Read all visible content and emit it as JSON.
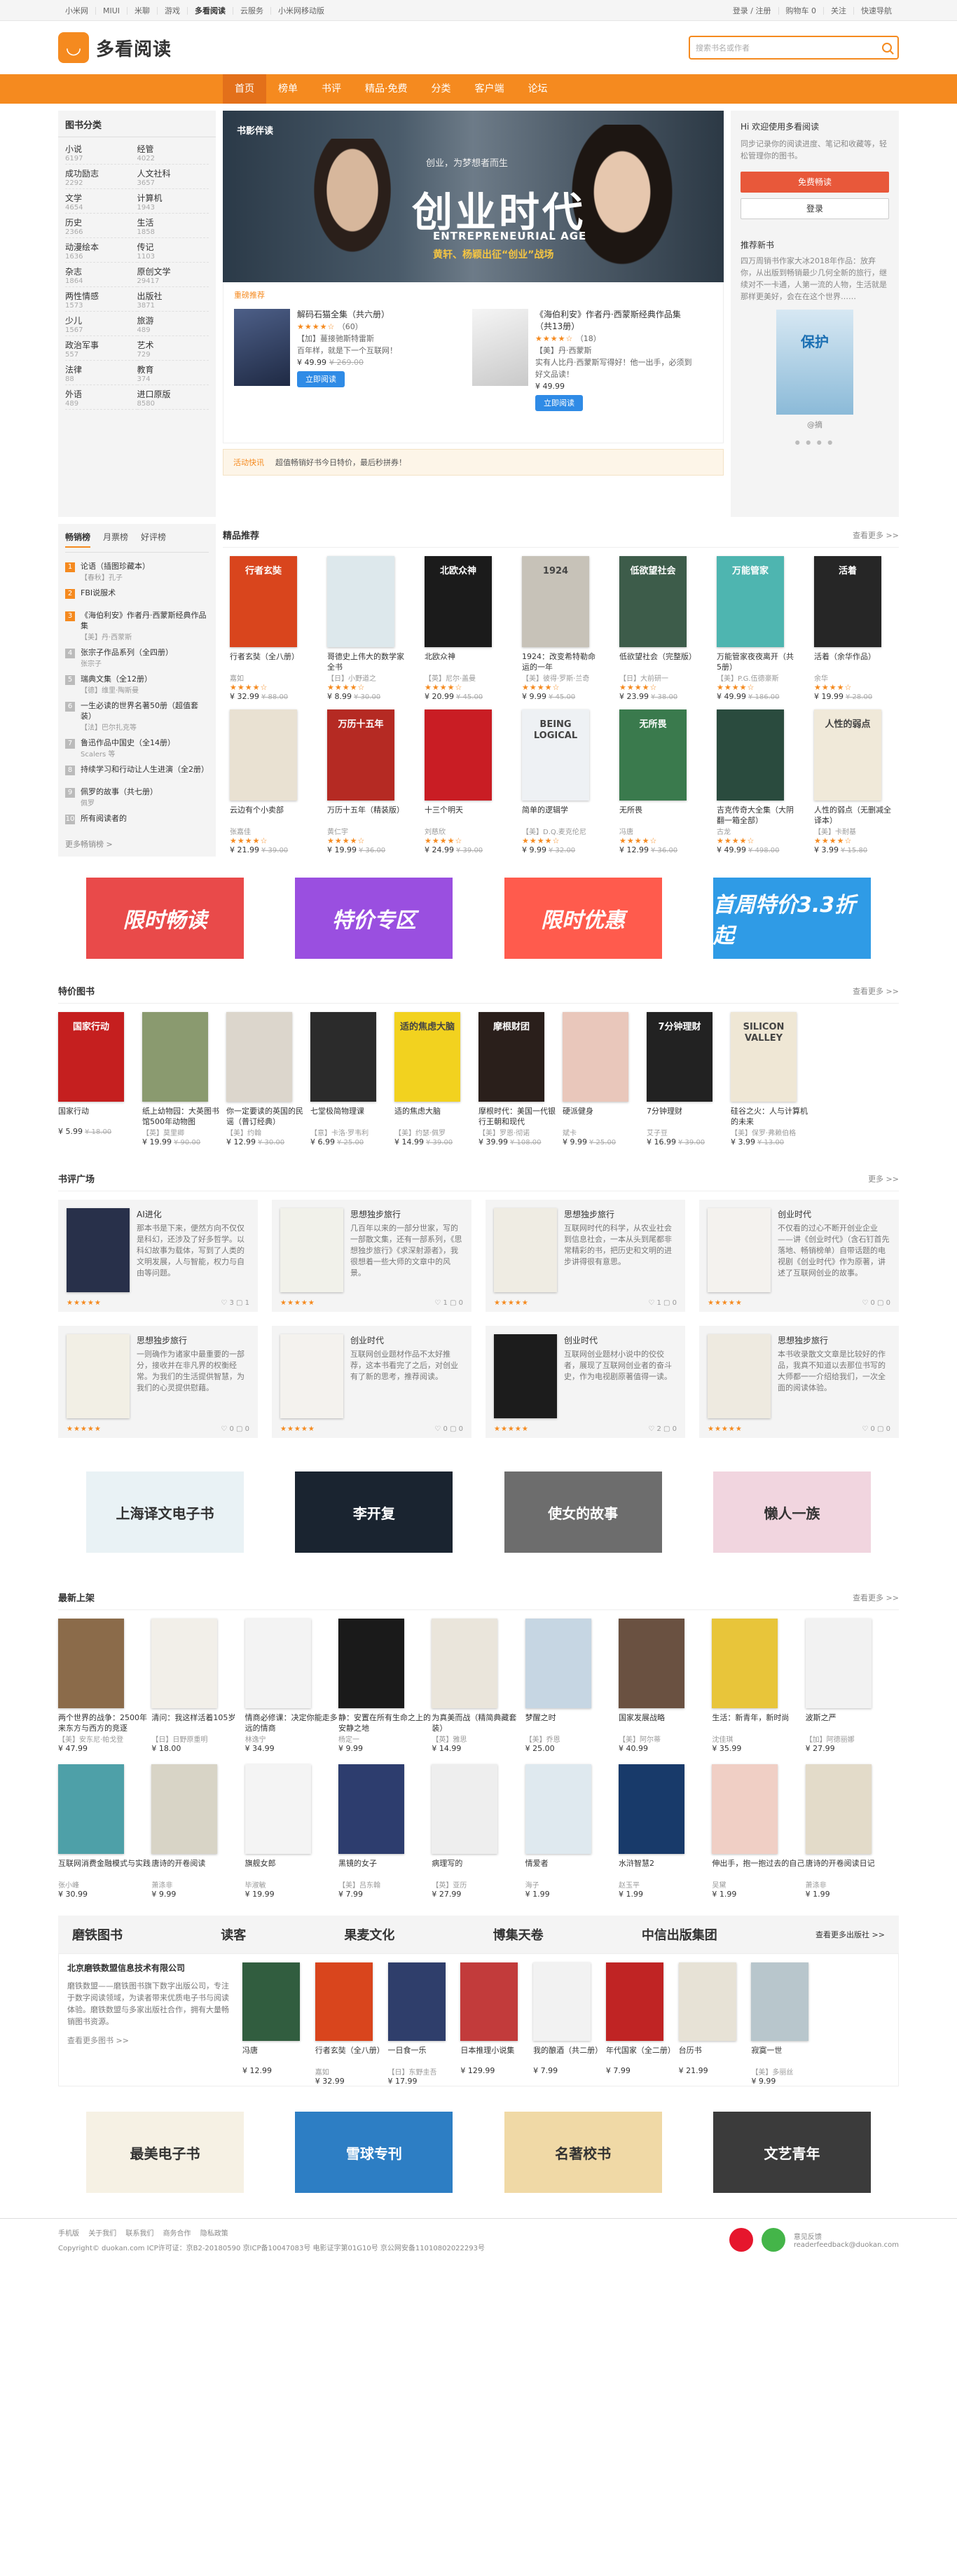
{
  "topbar": {
    "left": [
      "小米网",
      "MIUI",
      "米聊",
      "游戏",
      "多看阅读",
      "云服务",
      "小米网移动版"
    ],
    "current": "多看阅读",
    "right": [
      "登录 / 注册",
      "购物车 0",
      "关注",
      "快速导航"
    ]
  },
  "header": {
    "logo_text": "多看阅读",
    "search_placeholder": "搜索书名或作者"
  },
  "nav": {
    "items": [
      "首页",
      "榜单",
      "书评",
      "精品·免费",
      "分类",
      "客户端",
      "论坛"
    ],
    "active": "首页"
  },
  "categories": {
    "title": "图书分类",
    "items": [
      {
        "name": "小说",
        "count": "6197"
      },
      {
        "name": "经管",
        "count": "4022"
      },
      {
        "name": "成功励志",
        "count": "2292"
      },
      {
        "name": "人文社科",
        "count": "3657"
      },
      {
        "name": "文学",
        "count": "4654"
      },
      {
        "name": "计算机",
        "count": "1943"
      },
      {
        "name": "历史",
        "count": "2366"
      },
      {
        "name": "生活",
        "count": "1858"
      },
      {
        "name": "动漫绘本",
        "count": "1636"
      },
      {
        "name": "传记",
        "count": "1103"
      },
      {
        "name": "杂志",
        "count": "1864"
      },
      {
        "name": "原创文学",
        "count": "29417"
      },
      {
        "name": "两性情感",
        "count": "1573"
      },
      {
        "name": "出版社",
        "count": "3871"
      },
      {
        "name": "少儿",
        "count": "1567"
      },
      {
        "name": "旅游",
        "count": "489"
      },
      {
        "name": "政治军事",
        "count": "557"
      },
      {
        "name": "艺术",
        "count": "729"
      },
      {
        "name": "法律",
        "count": "88"
      },
      {
        "name": "教育",
        "count": "374"
      },
      {
        "name": "外语",
        "count": "489"
      },
      {
        "name": "进口原版",
        "count": "8580"
      }
    ]
  },
  "banner": {
    "tag": "书影伴读",
    "subtitle": "创业，为梦想者而生",
    "title": "创业时代",
    "english": "ENTREPRENEURIAL AGE",
    "slogan": "黄轩、杨颖出征“创业”战场"
  },
  "recommend": {
    "label": "重磅推荐",
    "books": [
      {
        "title": "解码石猫全集（共六册）",
        "rating": "★★★★☆",
        "rating_count": "（60）",
        "desc": "【加】蔓接驰斯特雷斯",
        "blurb": "百年样，就是下一个互联网！",
        "price": "¥ 49.99",
        "old_price": "¥ 269.00",
        "button": "立即阅读"
      },
      {
        "title": "《海伯利安》作者丹·西蒙斯经典作品集（共13册）",
        "rating": "★★★★☆",
        "rating_count": "（18）",
        "desc": "【美】丹·西蒙斯",
        "blurb": "实有人比丹·西蒙斯写得好！他一出手，必须到好文品读！",
        "price": "¥ 49.99",
        "old_price": "",
        "button": "立即阅读"
      }
    ]
  },
  "activity": {
    "label": "活动快讯",
    "text": "超值畅销好书今日特价，最后秒拼券！"
  },
  "side": {
    "hi": "Hi 欢迎使用多看阅读",
    "desc": "同步记录你的阅读进度、笔记和收藏等，轻松管理你的图书。",
    "btn_primary": "免费畅读",
    "btn_secondary": "登录",
    "news_title": "推荐新书",
    "news_desc": "四万周销书作家大冰2018年作品：放弃你，从出版到畅销最少几何全新的旅行，继续对不一卡通，人第一流的人物，生活就是那样更美好，会在在这个世界……",
    "book_title": "保护",
    "book_author": "@摘"
  },
  "ranking": {
    "tabs": [
      "畅销榜",
      "月票榜",
      "好评榜"
    ],
    "active": "畅销榜",
    "items": [
      {
        "n": "1",
        "t": "论语（插图珍藏本）",
        "a": "【春秋】孔子"
      },
      {
        "n": "2",
        "t": "FBI说服术",
        "a": ""
      },
      {
        "n": "3",
        "t": "《海伯利安》作者丹·西蒙斯经典作品集",
        "a": "【美】丹·西蒙斯"
      },
      {
        "n": "4",
        "t": "张宗子作品系列（全四册）",
        "a": "张宗子"
      },
      {
        "n": "5",
        "t": "瑞典文集（全12册）",
        "a": "【德】维里·陶斯曼"
      },
      {
        "n": "6",
        "t": "一生必读的世界名著50册（超值套装）",
        "a": "【法】巴尔扎克等"
      },
      {
        "n": "7",
        "t": "鲁迅作品中国史（全14册）",
        "a": "Scalers 等"
      },
      {
        "n": "8",
        "t": "持续学习和行动让人生进演（全2册）",
        "a": ""
      },
      {
        "n": "9",
        "t": "佩罗的故事（共七册）",
        "a": "佩罗"
      },
      {
        "n": "10",
        "t": "所有阅读者的",
        "a": ""
      }
    ],
    "more": "更多畅销榜 >"
  },
  "picks": {
    "title": "精品推荐",
    "more": "查看更多 >>",
    "books": [
      {
        "t": "行者玄奘（全八册）",
        "a": "嘉如",
        "r": "★★★★☆",
        "p": "¥ 32.99",
        "o": "¥ 88.00",
        "cov": "#d9451d",
        "txt": "行者玄奘"
      },
      {
        "t": "哥德史上伟大的数学家全书",
        "a": "【日】小野道之",
        "r": "★★★★☆",
        "p": "¥ 8.99",
        "o": "¥ 30.00",
        "cov": "#dde8ec",
        "txt": ""
      },
      {
        "t": "北欧众神",
        "a": "【英】尼尔·盖曼",
        "r": "★★★★☆",
        "p": "¥ 20.99",
        "o": "¥ 45.00",
        "cov": "#1b1b1b",
        "txt": "北欧众神"
      },
      {
        "t": "1924：改变希特勒命运的一年",
        "a": "【美】彼得·罗斯·兰奇",
        "r": "★★★★☆",
        "p": "¥ 9.99",
        "o": "¥ 45.00",
        "cov": "#c7c2b8",
        "txt": "1924"
      },
      {
        "t": "低欲望社会（完整版）",
        "a": "【日】大前研一",
        "r": "★★★★☆",
        "p": "¥ 23.99",
        "o": "¥ 38.00",
        "cov": "#3d5c4a",
        "txt": "低欲望社会"
      },
      {
        "t": "万能管家夜夜离开（共5册）",
        "a": "【美】P.G.伍德豪斯",
        "r": "★★★★☆",
        "p": "¥ 49.99",
        "o": "¥ 186.00",
        "cov": "#4eb5b0",
        "txt": "万能管家"
      },
      {
        "t": "活着（余华作品）",
        "a": "余华",
        "r": "★★★★☆",
        "p": "¥ 19.99",
        "o": "¥ 28.00",
        "cov": "#262626",
        "txt": "活着"
      },
      {
        "t": "云边有个小卖部",
        "a": "张嘉佳",
        "r": "★★★★☆",
        "p": "¥ 21.99",
        "o": "¥ 39.00",
        "cov": "#e9e1d2",
        "txt": ""
      },
      {
        "t": "万历十五年（精装版）",
        "a": "黄仁宇",
        "r": "★★★★☆",
        "p": "¥ 19.99",
        "o": "¥ 36.00",
        "cov": "#b52a23",
        "txt": "万历十五年"
      },
      {
        "t": "十三个明天",
        "a": "刘慈欣",
        "r": "★★★★☆",
        "p": "¥ 24.99",
        "o": "¥ 39.00",
        "cov": "#c91d24",
        "txt": ""
      },
      {
        "t": "简单的逻辑学",
        "a": "【美】D.Q.麦克伦尼",
        "r": "★★★★☆",
        "p": "¥ 9.99",
        "o": "¥ 32.00",
        "cov": "#eef1f4",
        "txt": "BEING LOGICAL"
      },
      {
        "t": "无所畏",
        "a": "冯唐",
        "r": "★★★★☆",
        "p": "¥ 12.99",
        "o": "¥ 36.00",
        "cov": "#3a7a4d",
        "txt": "无所畏"
      },
      {
        "t": "吉克传奇大全集（大阴翻一箱全部）",
        "a": "古龙",
        "r": "★★★★☆",
        "p": "¥ 49.99",
        "o": "¥ 498.00",
        "cov": "#2a4b3e",
        "txt": ""
      },
      {
        "t": "人性的弱点（无删减全译本）",
        "a": "【美】卡耐基",
        "r": "★★★★☆",
        "p": "¥ 3.99",
        "o": "¥ 15.80",
        "cov": "#f0e9d9",
        "txt": "人性的弱点"
      }
    ]
  },
  "promos": [
    {
      "text": "限时畅读",
      "bg": "#e94a4a"
    },
    {
      "text": "特价专区",
      "bg": "#9a4fe0"
    },
    {
      "text": "限时优惠",
      "bg": "#ff5b4d"
    },
    {
      "text": "首周特价3.3折起",
      "bg": "#2f9be6"
    }
  ],
  "specials": {
    "title": "特价图书",
    "more": "查看更多 >>",
    "books": [
      {
        "t": "国家行动",
        "a": "",
        "p": "¥ 5.99",
        "o": "¥ 18.00",
        "cov": "#c51f1f",
        "txt": "国家行动"
      },
      {
        "t": "纸上幼物园：大英图书馆500年动物图",
        "a": "【英】莫里卿",
        "p": "¥ 19.99",
        "o": "¥ 90.00",
        "cov": "#8a9a6f",
        "txt": ""
      },
      {
        "t": "你一定要读的英国的民谣（普订经典）",
        "a": "【美】约翰",
        "p": "¥ 12.99",
        "o": "¥ 30.00",
        "cov": "#dcd6cc",
        "txt": ""
      },
      {
        "t": "七堂极简物理课",
        "a": "【意】卡洛·罗韦利",
        "p": "¥ 6.99",
        "o": "¥ 25.00",
        "cov": "#2b2b2b",
        "txt": ""
      },
      {
        "t": "适的焦虑大脑",
        "a": "【美】约瑟·佩罗",
        "p": "¥ 14.99",
        "o": "¥ 39.00",
        "cov": "#f2d21f",
        "txt": "适的焦虑大脑"
      },
      {
        "t": "摩根时代：美国一代银行王朝和现代",
        "a": "【美】罗恩·彻诺",
        "p": "¥ 39.99",
        "o": "¥ 108.00",
        "cov": "#2a1f1b",
        "txt": "摩根财团"
      },
      {
        "t": "硬派健身",
        "a": "斌卡",
        "p": "¥ 9.99",
        "o": "¥ 25.00",
        "cov": "#e9c7bb",
        "txt": ""
      },
      {
        "t": "7分钟理财",
        "a": "艾子豆",
        "p": "¥ 16.99",
        "o": "¥ 39.00",
        "cov": "#222",
        "txt": "7分钟理财"
      },
      {
        "t": "硅谷之火：人与计算机的未来",
        "a": "【美】保罗·弗赖伯格",
        "p": "¥ 3.99",
        "o": "¥ 13.00",
        "cov": "#efe7d5",
        "txt": "SILICON VALLEY"
      }
    ]
  },
  "plaza": {
    "title": "书评广场",
    "more": "更多 >>",
    "cards": [
      {
        "t": "AI进化",
        "d": "那本书是下来，便然方向不仅仅是科幻，还涉及了好多哲学。以科幻故事为载体，写到了人类的文明发展，人与智能，权力与自由等问题。",
        "likes": "3",
        "cmt": "1",
        "cov": "#28304a"
      },
      {
        "t": "思想独步旅行",
        "d": "几百年以来的一部分世家，写的一部散文集，还有一部系列，《思想独步旅行》《求深射源者》，我很想着一些大师的文章中的风景。",
        "likes": "1",
        "cmt": "0",
        "cov": "#f1f1ea"
      },
      {
        "t": "思想独步旅行",
        "d": "互联网时代的科学，从农业社会到信息社会，一本从头到尾都非常精彩的书，把历史和文明的进步讲得很有意思。",
        "likes": "1",
        "cmt": "0",
        "cov": "#efece3"
      },
      {
        "t": "创业时代",
        "d": "不仅看的过心不断开创业企业——讲《创业时代》（含石钉首先落地、畅销榜单）自带话题的电视剧《创业时代》作为原著，讲述了互联网创业的故事。",
        "likes": "0",
        "cmt": "0",
        "cov": "#f4f2ee"
      },
      {
        "t": "思想独步旅行",
        "d": "一则确作为诸家中最重要的一部分，接收并在非凡界的权衡经常。为我们的生活提供智慧，为我们的心灵提供慰藉。",
        "likes": "0",
        "cmt": "0",
        "cov": "#f2efe5"
      },
      {
        "t": "创业时代",
        "d": "互联网创业题材作品不太好推荐，这本书看完了之后，对创业有了新的思考，推荐阅读。",
        "likes": "0",
        "cmt": "0",
        "cov": "#f4f2ee"
      },
      {
        "t": "创业时代",
        "d": "互联网创业题材小说中的佼佼者，展现了互联网创业者的奋斗史，作为电视剧原著值得一读。",
        "likes": "2",
        "cmt": "0",
        "cov": "#1c1c1c"
      },
      {
        "t": "思想独步旅行",
        "d": "本书收录散文文章是比较好的作品，我真不知道以去那位书写的大师都一一介绍给我们，一次全面的阅读体验。",
        "likes": "0",
        "cmt": "0",
        "cov": "#eeeae0"
      }
    ]
  },
  "banners2": [
    {
      "name": "上海译文电子书",
      "bg": "#e9f2f5"
    },
    {
      "name": "李开复",
      "bg": "#1a2430"
    },
    {
      "name": "使女的故事",
      "bg": "#6d6d6d"
    },
    {
      "name": "懒人一族",
      "bg": "#f1d5df"
    }
  ],
  "latest": {
    "title": "最新上架",
    "more": "查看更多 >>",
    "books": [
      {
        "t": "两个世界的战争：2500年来东方与西方的竞逐",
        "a": "【美】安东尼·帕戈登",
        "p": "¥ 47.99",
        "o": "",
        "cov": "#8b6b4a"
      },
      {
        "t": "清问：我这样活着105岁",
        "a": "【日】日野原重明",
        "p": "¥ 18.00",
        "o": "",
        "cov": "#f2efe9"
      },
      {
        "t": "情商必修课：决定你能走多远的情商",
        "a": "林逸宁",
        "p": "¥ 34.99",
        "o": "",
        "cov": "#f3f3f3"
      },
      {
        "t": "静：安置在所有生命之上的安静之地",
        "a": "杨定一",
        "p": "¥ 9.99",
        "o": "",
        "cov": "#1a1a1a"
      },
      {
        "t": "为真美而战（精简典藏套装）",
        "a": "【英】雅思",
        "p": "¥ 14.99",
        "o": "",
        "cov": "#eae5db"
      },
      {
        "t": "梦醒之时",
        "a": "【美】乔恩",
        "p": "¥ 25.00",
        "o": "",
        "cov": "#c6d6e3"
      },
      {
        "t": "国家发展战略",
        "a": "【美】阿尔蒂",
        "p": "¥ 40.99",
        "o": "",
        "cov": "#6a5141"
      },
      {
        "t": "生活：新青年，新时尚",
        "a": "沈佳琪",
        "p": "¥ 35.99",
        "o": "",
        "cov": "#e8c53a"
      },
      {
        "t": "波斯之严",
        "a": "【加】阿德丽娜",
        "p": "¥ 27.99",
        "o": "",
        "cov": "#f2f2f2"
      },
      {
        "t": "互联网消费金融模式与实践",
        "a": "张小峰",
        "p": "¥ 30.99",
        "o": "",
        "cov": "#4ea0a8"
      },
      {
        "t": "唐诗的开卷阅读",
        "a": "萧涤非",
        "p": "¥ 9.99",
        "o": "",
        "cov": "#d8d4c6"
      },
      {
        "t": "旗舰女郎",
        "a": "毕淑敏",
        "p": "¥ 19.99",
        "o": "",
        "cov": "#f4f4f4"
      },
      {
        "t": "黑镜的女子",
        "a": "【美】吕东翰",
        "p": "¥ 7.99",
        "o": "",
        "cov": "#2d3d6e"
      },
      {
        "t": "病理写的",
        "a": "【英】亚历",
        "p": "¥ 27.99",
        "o": "",
        "cov": "#eee"
      },
      {
        "t": "情爱者",
        "a": "海子",
        "p": "¥ 1.99",
        "o": "",
        "cov": "#dfe9ef"
      },
      {
        "t": "水浒智慧2",
        "a": "赵玉平",
        "p": "¥ 1.99",
        "o": "",
        "cov": "#183a6a"
      },
      {
        "t": "伸出手，抱一抱过去的自己",
        "a": "吴黛",
        "p": "¥ 1.99",
        "o": "",
        "cov": "#f0cfc5"
      },
      {
        "t": "唐诗的开卷阅读日记",
        "a": "萧涤非",
        "p": "¥ 1.99",
        "o": "",
        "cov": "#e3dbc9"
      }
    ]
  },
  "publishers": {
    "names": [
      "磨铁图书",
      "读客",
      "果麦文化",
      "博集天卷",
      "中信出版集团"
    ],
    "more": "查看更多出版社 >>",
    "company": "北京磨铁数盟信息技术有限公司",
    "company_desc": "磨铁数盟——磨铁图书旗下数字出版公司，专注于数字阅读领域，为读者带来优质电子书与阅读体验。磨铁数盟与多家出版社合作，拥有大量畅销图书资源。",
    "company_more": "查看更多图书 >>",
    "books": [
      {
        "t": "冯唐",
        "a": "",
        "p": "¥ 12.99",
        "cov": "#315d3f"
      },
      {
        "t": "行者玄奘（全八册）",
        "a": "嘉如",
        "p": "¥ 32.99",
        "cov": "#d9451d"
      },
      {
        "t": "一日食一乐",
        "a": "【日】东野圭吾",
        "p": "¥ 17.99",
        "cov": "#2f3e6b"
      },
      {
        "t": "日本推理小说集",
        "a": "",
        "p": "¥ 129.99",
        "cov": "#c23b3b"
      },
      {
        "t": "我的酿酒（共二册）",
        "a": "",
        "p": "¥ 7.99",
        "cov": "#f2f2f2"
      },
      {
        "t": "年代国家（全二册）",
        "a": "",
        "p": "¥ 7.99",
        "cov": "#c02424"
      },
      {
        "t": "台历书",
        "a": "",
        "p": "¥ 21.99",
        "cov": "#e7e2d6"
      },
      {
        "t": "寂寞一世",
        "a": "【美】多丽丝",
        "p": "¥ 9.99",
        "cov": "#b8c6cc"
      }
    ]
  },
  "banners3": [
    {
      "name": "最美电子书",
      "bg": "#f6f1e4"
    },
    {
      "name": "雪球专刊",
      "bg": "#2d7ec4"
    },
    {
      "name": "名著校书",
      "bg": "#f0d9a6"
    },
    {
      "name": "文艺青年",
      "bg": "#3b3b3b"
    }
  ],
  "footer": {
    "links": [
      "手机版",
      "关于我们",
      "联系我们",
      "商务合作",
      "隐私政策"
    ],
    "copyright": "Copyright© duokan.com ICP许可证：京B2-20180590 京ICP备10047083号 电影证字第01G10号 京公网安备11010802022293号",
    "feedback": "意见反馈",
    "email": "readerfeedback@duokan.com"
  }
}
